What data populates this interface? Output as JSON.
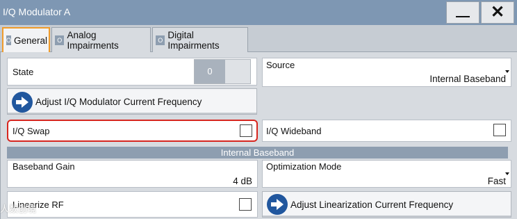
{
  "window": {
    "title": "I/Q Modulator A",
    "minimize_icon": "minimize-icon",
    "close_icon": "close-icon"
  },
  "tabs": [
    {
      "indicator": "O",
      "label": "General",
      "active": true
    },
    {
      "indicator": "O",
      "label": "Analog Impairments",
      "active": false
    },
    {
      "indicator": "O",
      "label": "Digital Impairments",
      "active": false
    }
  ],
  "general": {
    "state": {
      "label": "State",
      "toggle_value": "0"
    },
    "source": {
      "label": "Source",
      "value": "Internal Baseband"
    },
    "adjust_iq": {
      "label": "Adjust I/Q Modulator Current Frequency",
      "icon": "arrow-right-icon"
    },
    "iq_swap": {
      "label": "I/Q Swap",
      "checked": false
    },
    "iq_wideband": {
      "label": "I/Q Wideband",
      "checked": false
    },
    "section_internal_baseband": "Internal Baseband",
    "baseband_gain": {
      "label": "Baseband Gain",
      "value": "4 dB"
    },
    "optimization_mode": {
      "label": "Optimization Mode",
      "value": "Fast"
    },
    "linearize_rf": {
      "label": "Linearize RF",
      "checked": false
    },
    "adjust_linearization": {
      "label": "Adjust Linearization Current Frequency",
      "icon": "arrow-right-icon"
    }
  },
  "colors": {
    "titlebar": "#7e97b3",
    "active_tab_border": "#ef9b2b",
    "highlight_border": "#d7261f",
    "action_icon": "#21579e"
  },
  "watermark": "人数创境"
}
